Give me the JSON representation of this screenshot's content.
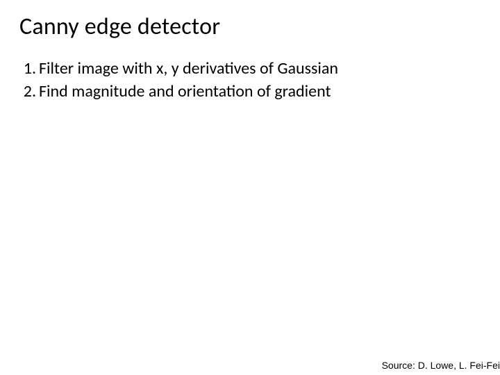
{
  "title": "Canny edge detector",
  "items": [
    "Filter image with x, y derivatives of Gaussian",
    "Find magnitude and orientation of gradient"
  ],
  "source": "Source: D. Lowe, L. Fei-Fei"
}
